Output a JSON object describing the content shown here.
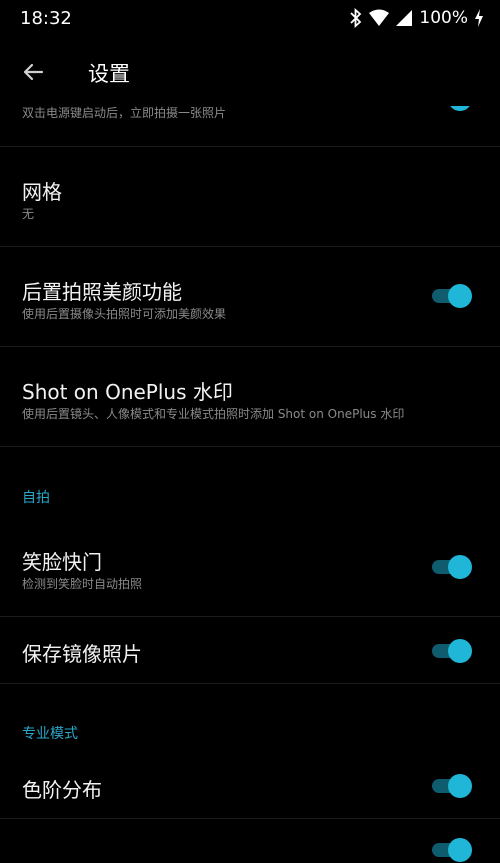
{
  "status": {
    "time": "18:32",
    "battery": "100%"
  },
  "header": {
    "title": "设置"
  },
  "colors": {
    "accent": "#1fb6d8",
    "section": "#2aa7c9",
    "background": "#000000"
  },
  "rows": [
    {
      "subtitle": "双击电源键启动后，立即拍摄一张照片",
      "toggle_on": true
    },
    {
      "title": "网格",
      "subtitle": "无"
    },
    {
      "title": "后置拍照美颜功能",
      "subtitle": "使用后置摄像头拍照时可添加美颜效果",
      "toggle_on": true
    },
    {
      "title": "Shot on OnePlus 水印",
      "subtitle": "使用后置镜头、人像模式和专业模式拍照时添加 Shot on OnePlus 水印"
    }
  ],
  "sections": {
    "selfie": "自拍",
    "pro_mode": "专业模式"
  },
  "selfie_rows": [
    {
      "title": "笑脸快门",
      "subtitle": "检测到笑脸时自动拍照",
      "toggle_on": true
    },
    {
      "title": "保存镜像照片",
      "toggle_on": true
    }
  ],
  "pro_rows": [
    {
      "title": "色阶分布",
      "toggle_on": true
    }
  ]
}
